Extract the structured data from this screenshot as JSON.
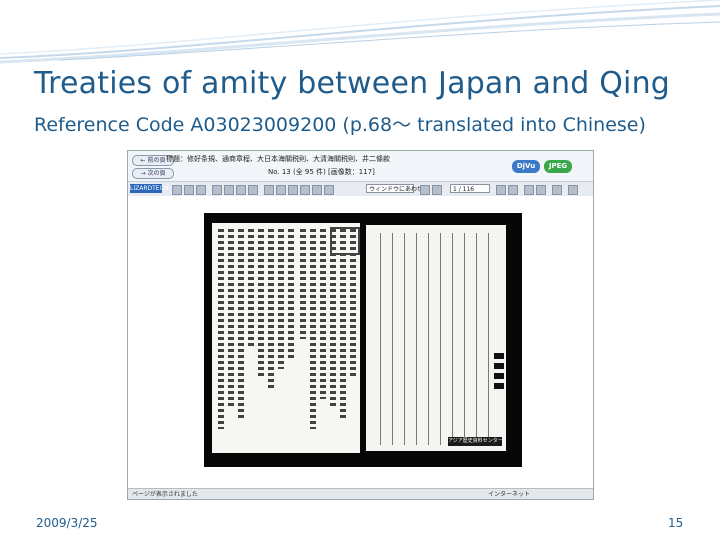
{
  "slide": {
    "title": "Treaties of amity between Japan and Qing",
    "subtitle": "Reference Code A03023009200 (p.68～ translated into Chinese)",
    "date": "2009/3/25",
    "page_number": "15",
    "accent_color": "#1f5c8c"
  },
  "screenshot": {
    "header_line1": "標題：修好条規、通商章程、大日本海關税則、大清海關税則、井二條款",
    "header_line2": "No. 13 (全 95 件)  [画像数：117]",
    "nav_prev": "← 前の頁",
    "nav_next": "→ 次の頁",
    "format_djvu": "DjVu",
    "format_jpeg": "JPEG",
    "format_djvu_color": "#3a78c8",
    "format_jpeg_color": "#3aa84a",
    "logo": "LIZARDTECH",
    "zoom_select": "ウィンドウにあわせる",
    "page_select": "1 / 116",
    "status_left": "ページが表示されました",
    "status_right": "インターネット",
    "archive_stamp": "アジア歴史資料センター"
  }
}
